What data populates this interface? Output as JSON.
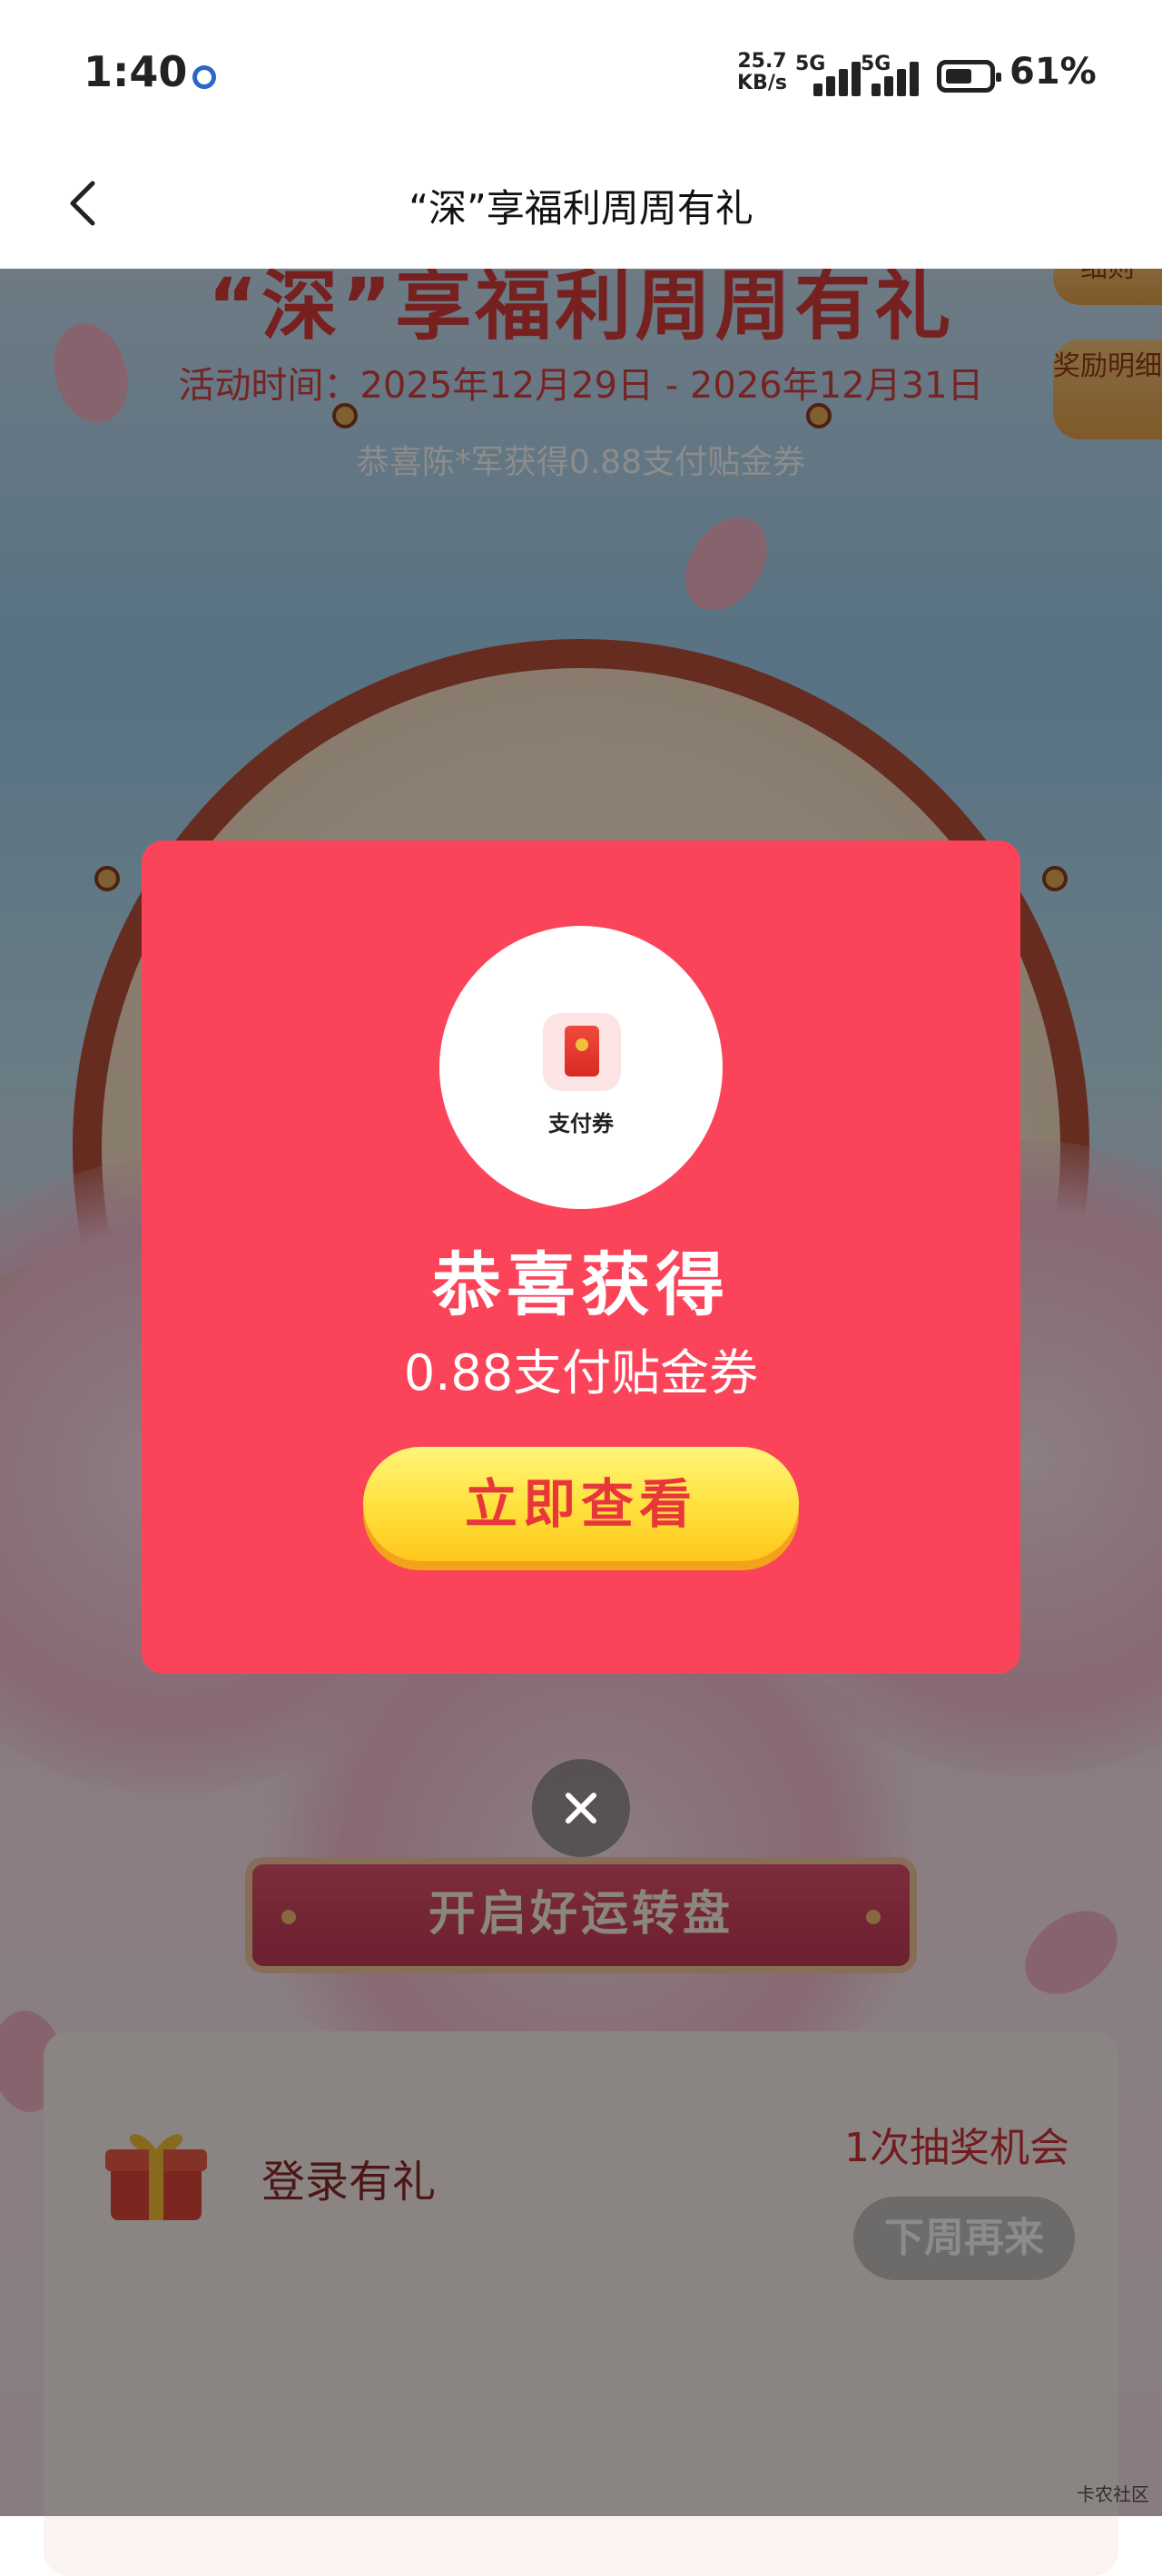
{
  "status_bar": {
    "time": "1:40",
    "net_speed_value": "25.7",
    "net_speed_unit": "KB/s",
    "sim1_label": "5G",
    "sim2_label": "5G",
    "battery": "61%",
    "battery_level": 0.61
  },
  "nav": {
    "title": "“深”享福利周周有礼",
    "back_icon": "chevron-left-icon"
  },
  "background": {
    "title": "“深”享福利周周有礼",
    "activity_time": "活动时间：2025年12月29日 - 2026年12月31日",
    "ticker": "恭喜陈*军获得0.88支付贴金券",
    "side_tab_top": "细则",
    "side_tab_reward": "奖励明细",
    "wheel_banner": "开启好运转盘",
    "task": {
      "name": "登录有礼",
      "chances": "1次抽奖机会",
      "button": "下周再来"
    },
    "watermark": "卡农社区"
  },
  "modal": {
    "coupon_label": "支付券",
    "coupon_icon": "red-envelope-icon",
    "heading": "恭喜获得",
    "prize": "0.88支付贴金券",
    "view_button": "立即查看",
    "close_icon": "close-icon",
    "colors": {
      "background": "#fb4459",
      "button": "#ffe03a",
      "button_text": "#e8373b"
    }
  }
}
